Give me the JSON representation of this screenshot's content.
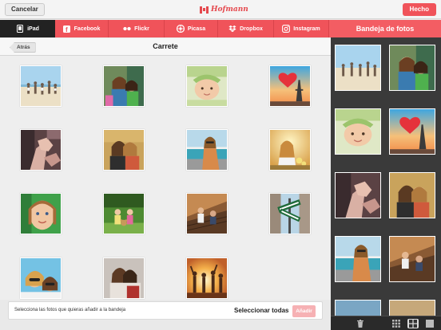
{
  "topbar": {
    "cancel_label": "Cancelar",
    "logo_text": "Hofmann",
    "done_label": "Hecho"
  },
  "tabs": [
    {
      "label": "iPad",
      "icon": "ipad-icon",
      "active": true
    },
    {
      "label": "Facebook",
      "icon": "facebook-icon",
      "active": false
    },
    {
      "label": "Flickr",
      "icon": "flickr-icon",
      "active": false
    },
    {
      "label": "Picasa",
      "icon": "picasa-icon",
      "active": false
    },
    {
      "label": "Dropbox",
      "icon": "dropbox-icon",
      "active": false
    },
    {
      "label": "Instagram",
      "icon": "instagram-icon",
      "active": false
    }
  ],
  "tray": {
    "title": "Bandeja de fotos",
    "thumbs": [
      "beach-friends",
      "selfie-friends",
      "baby-blanket",
      "eiffel-heart",
      "couple-hands",
      "women-selfie-bus",
      "woman-tram-sunglasses",
      "couple-stairs"
    ],
    "footer_icons": [
      "trash-icon",
      "grid-small-icon",
      "grid-medium-icon",
      "grid-large-icon"
    ]
  },
  "album": {
    "back_label": "Atrás",
    "title": "Carrete",
    "photos": [
      "beach-friends",
      "selfie-friends",
      "baby-blanket",
      "eiffel-heart",
      "couple-hands",
      "women-selfie-bus",
      "woman-tram-sunglasses",
      "girl-sunset-flowers",
      "girl-portrait",
      "kids-teddy",
      "couple-stairs",
      "street-signs",
      "friends-sunglasses",
      "women-hugging",
      "party-sunset"
    ]
  },
  "bottom": {
    "hint": "Selecciona las fotos que quieras añadir a la bandeja",
    "select_all_label": "Seleccionar todas",
    "add_label": "Añadir"
  },
  "colors": {
    "accent": "#f0535a",
    "active_tab": "#222222",
    "tray_bg": "#3a3a3a"
  }
}
